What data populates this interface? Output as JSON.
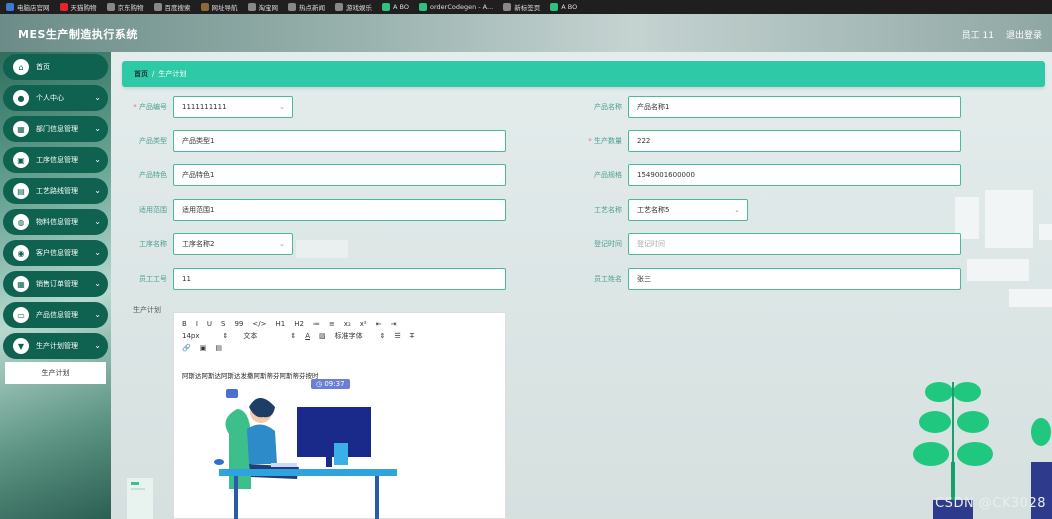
{
  "bookmarks": [
    {
      "label": "电脑店官网",
      "color": "#3b7bd8"
    },
    {
      "label": "天猫购物",
      "color": "#e8232a"
    },
    {
      "label": "京东购物",
      "color": "#888888"
    },
    {
      "label": "百度搜索",
      "color": "#888888"
    },
    {
      "label": "网址导航",
      "color": "#8b6a3a"
    },
    {
      "label": "淘宝网",
      "color": "#888888"
    },
    {
      "label": "热点新闻",
      "color": "#888888"
    },
    {
      "label": "游戏娱乐",
      "color": "#888888"
    },
    {
      "label": "A BO",
      "color": "#2ec27e"
    },
    {
      "label": "orderCodegen - A...",
      "color": "#2ec27e"
    },
    {
      "label": "新标签页",
      "color": "#888888"
    },
    {
      "label": "A BO",
      "color": "#2ec27e"
    }
  ],
  "app_title": "MES生产制造执行系统",
  "user": {
    "name": "员工 11",
    "logout": "退出登录"
  },
  "sidebar": {
    "items": [
      {
        "label": "首页",
        "icon": "home-icon",
        "has_chevron": false
      },
      {
        "label": "个人中心",
        "icon": "user-icon",
        "has_chevron": true
      },
      {
        "label": "部门信息管理",
        "icon": "grid-icon",
        "has_chevron": true
      },
      {
        "label": "工序信息管理",
        "icon": "bag-icon",
        "has_chevron": true
      },
      {
        "label": "工艺路线管理",
        "icon": "chart-icon",
        "has_chevron": true
      },
      {
        "label": "物料信息管理",
        "icon": "data-icon",
        "has_chevron": true
      },
      {
        "label": "客户信息管理",
        "icon": "people-icon",
        "has_chevron": true
      },
      {
        "label": "销售订单管理",
        "icon": "grid-icon",
        "has_chevron": true
      },
      {
        "label": "产品信息管理",
        "icon": "monitor-icon",
        "has_chevron": true
      },
      {
        "label": "生产计划管理",
        "icon": "pin-icon",
        "has_chevron": true
      }
    ],
    "submenu": "生产计划"
  },
  "breadcrumb": {
    "home": "首页",
    "sep": "/",
    "current": "生产计划"
  },
  "form": {
    "product_no": {
      "label": "产品编号",
      "value": "1111111111"
    },
    "product_name": {
      "label": "产品名称",
      "value": "产品名称1"
    },
    "product_type": {
      "label": "产品类型",
      "value": "产品类型1"
    },
    "quantity": {
      "label": "生产数量",
      "value": "222"
    },
    "product_feature": {
      "label": "产品特色",
      "value": "产品特色1"
    },
    "product_spec": {
      "label": "产品规格",
      "value": "1549001600000"
    },
    "scope": {
      "label": "适用范围",
      "value": "适用范围1"
    },
    "craft_name": {
      "label": "工艺名称",
      "value": "工艺名称5"
    },
    "process_name": {
      "label": "工序名称",
      "value": "工序名称2"
    },
    "register_time": {
      "label": "登记时间",
      "placeholder": "登记时间"
    },
    "emp_no": {
      "label": "员工工号",
      "value": "11"
    },
    "emp_name": {
      "label": "员工姓名",
      "value": "张三"
    },
    "plan": {
      "label": "生产计划"
    }
  },
  "editor": {
    "row1": [
      "B",
      "I",
      "U",
      "S",
      "99",
      "</>",
      "H1",
      "H2",
      "≔",
      "≡",
      "x₂",
      "x²",
      "⇤",
      "⇥"
    ],
    "font_size": "14px",
    "text_type": "文本",
    "font_family": "标准字体",
    "content": "阿斯达阿斯达阿斯达发撒阿斯蒂芬阿斯蒂芬按时",
    "time_badge": "09:37"
  },
  "watermark": "CSDN @CK3028"
}
